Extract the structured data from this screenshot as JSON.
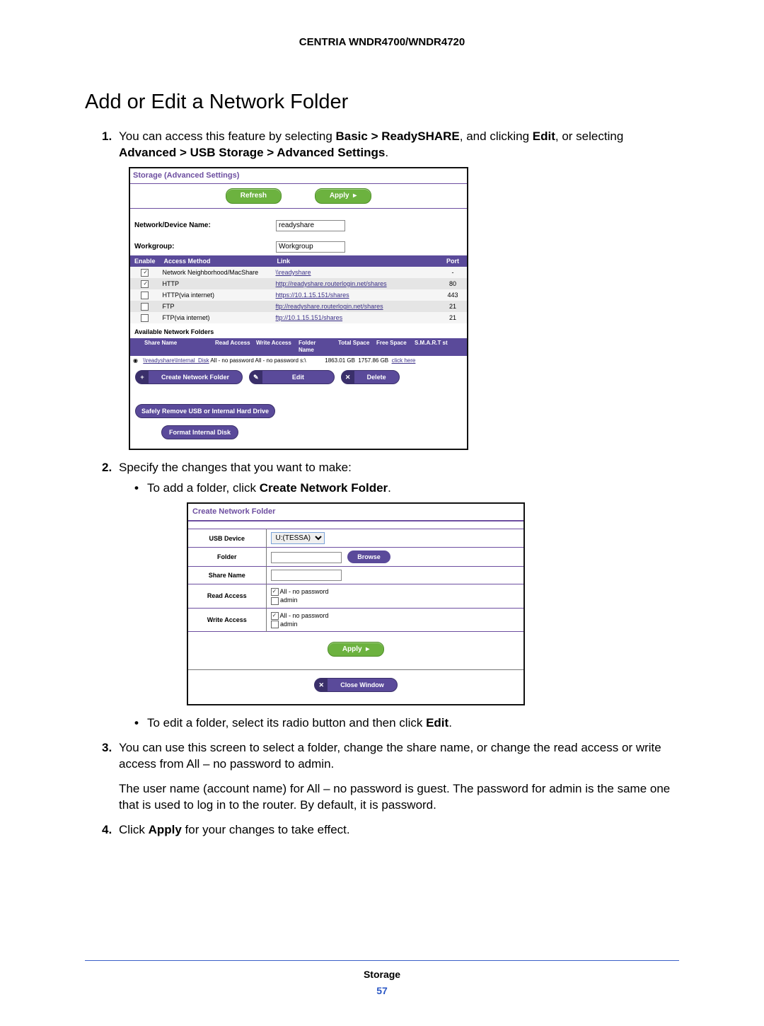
{
  "header": {
    "title": "CENTRIA WNDR4700/WNDR4720"
  },
  "section": {
    "title": "Add or Edit a Network Folder"
  },
  "steps": {
    "s1_a": "You can access this feature by selecting ",
    "s1_b": "Basic > ReadySHARE",
    "s1_c": ", and clicking ",
    "s1_d": "Edit",
    "s1_e": ", or selecting ",
    "s1_f": "Advanced > USB Storage > Advanced Settings",
    "s1_g": ".",
    "s2": "Specify the changes that you want to make:",
    "s2_b1_a": "To add a folder, click ",
    "s2_b1_b": "Create Network Folder",
    "s2_b1_c": ".",
    "s2_b2_a": "To edit a folder, select its radio button and then click ",
    "s2_b2_b": "Edit",
    "s2_b2_c": ".",
    "s3_a": "You can use this screen to select a folder, change the share name, or change the read access or write access from All – no password to admin.",
    "s3_b": "The user name (account name) for All – no password is guest. The password for admin is the same one that is used to log in to the router. By default, it is password.",
    "s4_a": "Click ",
    "s4_b": "Apply",
    "s4_c": " for your changes to take effect."
  },
  "panel1": {
    "title": "Storage (Advanced Settings)",
    "refresh": "Refresh",
    "apply": "Apply",
    "net_lbl": "Network/Device Name:",
    "net_val": "readyshare",
    "wg_lbl": "Workgroup:",
    "wg_val": "Workgroup",
    "th_enable": "Enable",
    "th_method": "Access Method",
    "th_link": "Link",
    "th_port": "Port",
    "rows": [
      {
        "chk": true,
        "method": "Network Neighborhood/MacShare",
        "link": "\\\\readyshare",
        "port": "-"
      },
      {
        "chk": true,
        "method": "HTTP",
        "link": "http://readyshare.routerlogin.net/shares",
        "port": "80"
      },
      {
        "chk": false,
        "method": "HTTP(via internet)",
        "link": "https://10.1.15.151/shares",
        "port": "443"
      },
      {
        "chk": false,
        "method": "FTP",
        "link": "ftp://readyshare.routerlogin.net/shares",
        "port": "21"
      },
      {
        "chk": false,
        "method": "FTP(via internet)",
        "link": "ftp://10.1.15.151/shares",
        "port": "21"
      }
    ],
    "avail": "Available Network Folders",
    "fh_share": "Share Name",
    "fh_read": "Read Access",
    "fh_write": "Write Access",
    "fh_folder": "Folder Name",
    "fh_total": "Total Space",
    "fh_free": "Free Space",
    "fh_smart": "S.M.A.R.T st",
    "frow": {
      "share": "\\\\readyshare\\Internal_Disk",
      "read": "All - no password",
      "write": "All - no password",
      "folder": "s:\\",
      "total": "1863.01 GB",
      "free": "1757.86 GB",
      "smart": "click here"
    },
    "create": "Create Network Folder",
    "edit": "Edit",
    "delete": "Delete",
    "safely": "Safely Remove USB or Internal Hard Drive",
    "format": "Format Internal Disk"
  },
  "panel2": {
    "title": "Create Network Folder",
    "usb_lbl": "USB Device",
    "usb_val": "U:(TESSA)",
    "folder_lbl": "Folder",
    "browse": "Browse",
    "share_lbl": "Share Name",
    "read_lbl": "Read Access",
    "write_lbl": "Write Access",
    "opt1": "All - no password",
    "opt2": "admin",
    "apply": "Apply",
    "close": "Close Window"
  },
  "footer": {
    "label": "Storage",
    "page": "57"
  }
}
